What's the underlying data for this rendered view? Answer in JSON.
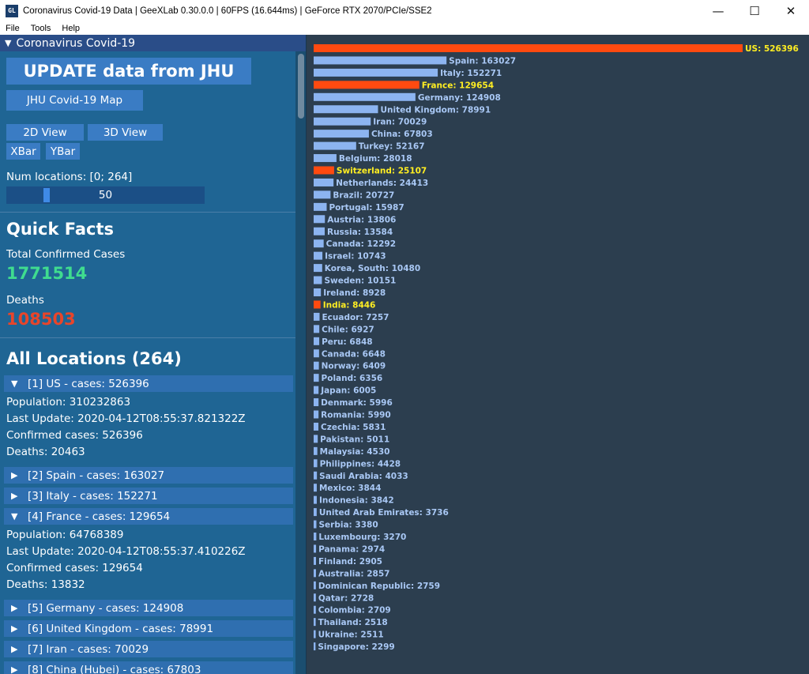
{
  "window": {
    "title": "Coronavirus Covid-19 Data | GeeXLab 0.30.0.0 | 60FPS (16.644ms) | GeForce RTX 2070/PCIe/SSE2",
    "icon_text": "GL",
    "minimize_glyph": "—",
    "maximize_glyph": "☐",
    "close_glyph": "✕"
  },
  "menu": [
    "File",
    "Tools",
    "Help"
  ],
  "panel": {
    "header": "Coronavirus Covid-19",
    "update_button": "UPDATE data from JHU",
    "map_button": "JHU Covid-19 Map",
    "view2d_button": "2D View",
    "view3d_button": "3D View",
    "xbar_button": "XBar",
    "ybar_button": "YBar",
    "num_locations_label": "Num locations: [0; 264]",
    "num_locations_value": "50",
    "num_locations_fraction": 0.189
  },
  "quick_facts": {
    "title": "Quick Facts",
    "total_confirmed_label": "Total Confirmed Cases",
    "total_confirmed_value": "1771514",
    "deaths_label": "Deaths",
    "deaths_value": "108503",
    "confirmed_color": "#3fdc8f",
    "deaths_color": "#e8452a"
  },
  "locations": {
    "title": "All Locations (264)",
    "items": [
      {
        "label": "[1] US - cases: 526396",
        "expanded": true,
        "details": [
          "Population: 310232863",
          "Last Update: 2020-04-12T08:55:37.821322Z",
          "Confirmed cases: 526396",
          "Deaths: 20463"
        ]
      },
      {
        "label": "[2] Spain - cases: 163027",
        "expanded": false
      },
      {
        "label": "[3] Italy - cases: 152271",
        "expanded": false
      },
      {
        "label": "[4] France - cases: 129654",
        "expanded": true,
        "details": [
          "Population: 64768389",
          "Last Update: 2020-04-12T08:55:37.410226Z",
          "Confirmed cases: 129654",
          "Deaths: 13832"
        ]
      },
      {
        "label": "[5] Germany - cases: 124908",
        "expanded": false
      },
      {
        "label": "[6] United Kingdom - cases: 78991",
        "expanded": false
      },
      {
        "label": "[7] Iran - cases: 70029",
        "expanded": false
      },
      {
        "label": "[8] China (Hubei) - cases: 67803",
        "expanded": false
      }
    ]
  },
  "chart_data": {
    "type": "bar",
    "orientation": "horizontal",
    "highlight_color": "#ff4a10",
    "bar_color": "#8cb4f0",
    "highlight_label_color": "#ffee22",
    "label_color": "#a9c8f5",
    "bars": [
      {
        "name": "US",
        "value": 526396,
        "highlight": true
      },
      {
        "name": "Spain",
        "value": 163027,
        "highlight": false
      },
      {
        "name": "Italy",
        "value": 152271,
        "highlight": false
      },
      {
        "name": "France",
        "value": 129654,
        "highlight": true
      },
      {
        "name": "Germany",
        "value": 124908,
        "highlight": false
      },
      {
        "name": "United Kingdom",
        "value": 78991,
        "highlight": false
      },
      {
        "name": "Iran",
        "value": 70029,
        "highlight": false
      },
      {
        "name": "China",
        "value": 67803,
        "highlight": false
      },
      {
        "name": "Turkey",
        "value": 52167,
        "highlight": false
      },
      {
        "name": "Belgium",
        "value": 28018,
        "highlight": false
      },
      {
        "name": "Switzerland",
        "value": 25107,
        "highlight": true
      },
      {
        "name": "Netherlands",
        "value": 24413,
        "highlight": false
      },
      {
        "name": "Brazil",
        "value": 20727,
        "highlight": false
      },
      {
        "name": "Portugal",
        "value": 15987,
        "highlight": false
      },
      {
        "name": "Austria",
        "value": 13806,
        "highlight": false
      },
      {
        "name": "Russia",
        "value": 13584,
        "highlight": false
      },
      {
        "name": "Canada",
        "value": 12292,
        "highlight": false
      },
      {
        "name": "Israel",
        "value": 10743,
        "highlight": false
      },
      {
        "name": "Korea, South",
        "value": 10480,
        "highlight": false
      },
      {
        "name": "Sweden",
        "value": 10151,
        "highlight": false
      },
      {
        "name": "Ireland",
        "value": 8928,
        "highlight": false
      },
      {
        "name": "India",
        "value": 8446,
        "highlight": true
      },
      {
        "name": "Ecuador",
        "value": 7257,
        "highlight": false
      },
      {
        "name": "Chile",
        "value": 6927,
        "highlight": false
      },
      {
        "name": "Peru",
        "value": 6848,
        "highlight": false
      },
      {
        "name": "Canada",
        "value": 6648,
        "highlight": false
      },
      {
        "name": "Norway",
        "value": 6409,
        "highlight": false
      },
      {
        "name": "Poland",
        "value": 6356,
        "highlight": false
      },
      {
        "name": "Japan",
        "value": 6005,
        "highlight": false
      },
      {
        "name": "Denmark",
        "value": 5996,
        "highlight": false
      },
      {
        "name": "Romania",
        "value": 5990,
        "highlight": false
      },
      {
        "name": "Czechia",
        "value": 5831,
        "highlight": false
      },
      {
        "name": "Pakistan",
        "value": 5011,
        "highlight": false
      },
      {
        "name": "Malaysia",
        "value": 4530,
        "highlight": false
      },
      {
        "name": "Philippines",
        "value": 4428,
        "highlight": false
      },
      {
        "name": "Saudi Arabia",
        "value": 4033,
        "highlight": false
      },
      {
        "name": "Mexico",
        "value": 3844,
        "highlight": false
      },
      {
        "name": "Indonesia",
        "value": 3842,
        "highlight": false
      },
      {
        "name": "United Arab Emirates",
        "value": 3736,
        "highlight": false
      },
      {
        "name": "Serbia",
        "value": 3380,
        "highlight": false
      },
      {
        "name": "Luxembourg",
        "value": 3270,
        "highlight": false
      },
      {
        "name": "Panama",
        "value": 2974,
        "highlight": false
      },
      {
        "name": "Finland",
        "value": 2905,
        "highlight": false
      },
      {
        "name": "Australia",
        "value": 2857,
        "highlight": false
      },
      {
        "name": "Dominican Republic",
        "value": 2759,
        "highlight": false
      },
      {
        "name": "Qatar",
        "value": 2728,
        "highlight": false
      },
      {
        "name": "Colombia",
        "value": 2709,
        "highlight": false
      },
      {
        "name": "Thailand",
        "value": 2518,
        "highlight": false
      },
      {
        "name": "Ukraine",
        "value": 2511,
        "highlight": false
      },
      {
        "name": "Singapore",
        "value": 2299,
        "highlight": false
      }
    ]
  }
}
